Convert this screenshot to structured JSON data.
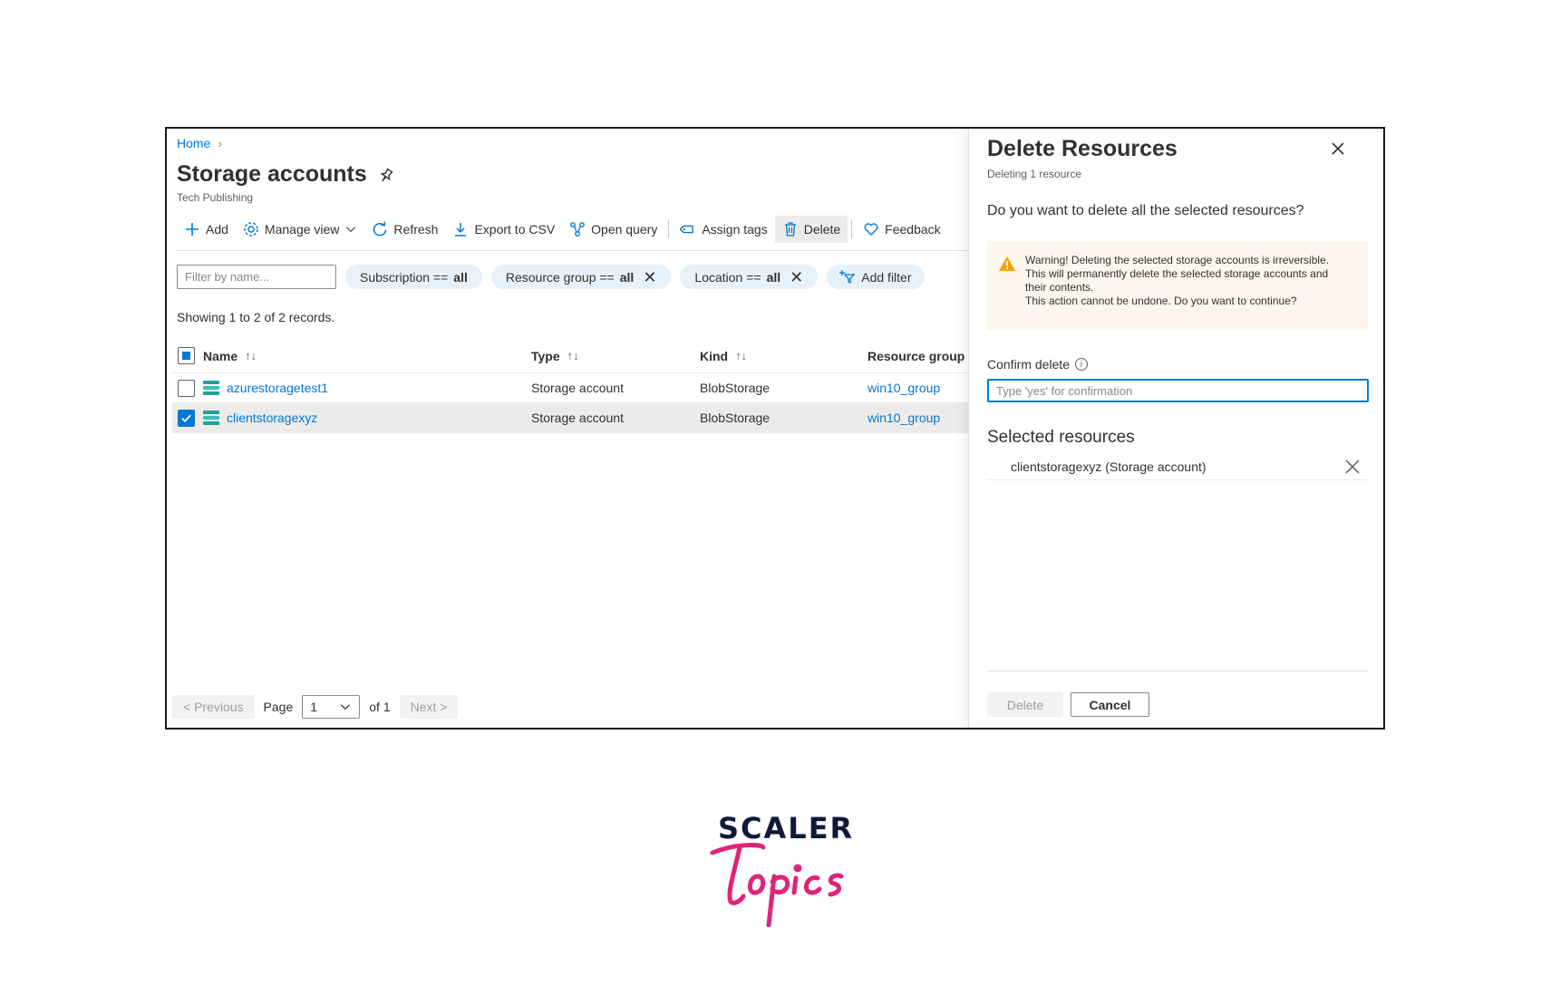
{
  "breadcrumb": {
    "home": "Home",
    "chevron": "›"
  },
  "page": {
    "title": "Storage accounts",
    "subtitle": "Tech Publishing"
  },
  "toolbar": {
    "add": "Add",
    "manage_view": "Manage view",
    "refresh": "Refresh",
    "export_csv": "Export to CSV",
    "open_query": "Open query",
    "assign_tags": "Assign tags",
    "delete": "Delete",
    "feedback": "Feedback"
  },
  "filters": {
    "name_placeholder": "Filter by name...",
    "subscription": {
      "label": "Subscription ==",
      "value": "all"
    },
    "resource_group": {
      "label": "Resource group ==",
      "value": "all"
    },
    "location": {
      "label": "Location ==",
      "value": "all"
    },
    "add_filter": "Add filter",
    "remove_glyph": "✕"
  },
  "records_text": "Showing 1 to 2 of 2 records.",
  "table": {
    "columns": {
      "name": "Name",
      "type": "Type",
      "kind": "Kind",
      "resource_group": "Resource group"
    },
    "sort_glyph": "↑↓",
    "rows": [
      {
        "name": "azurestoragetest1",
        "type": "Storage account",
        "kind": "BlobStorage",
        "resource_group": "win10_group",
        "checked": false
      },
      {
        "name": "clientstoragexyz",
        "type": "Storage account",
        "kind": "BlobStorage",
        "resource_group": "win10_group",
        "checked": true
      }
    ]
  },
  "pager": {
    "previous": "< Previous",
    "page_label": "Page",
    "page_value": "1",
    "of_label": "of 1",
    "next": "Next >"
  },
  "panel": {
    "title": "Delete Resources",
    "subtitle": "Deleting 1 resource",
    "question": "Do you want to delete all the selected resources?",
    "warning_lines": [
      "Warning! Deleting the selected storage accounts is irreversible.",
      "This will permanently delete the selected storage accounts and",
      "their contents.",
      "This action cannot be undone. Do you want to continue?"
    ],
    "confirm_label": "Confirm delete",
    "confirm_placeholder": "Type 'yes' for confirmation",
    "info_glyph": "i",
    "selected_title": "Selected resources",
    "selected_item": "clientstoragexyz (Storage account)",
    "delete_button": "Delete",
    "cancel_button": "Cancel"
  },
  "logo": {
    "top": "SCALER",
    "bottom": "Topics"
  },
  "colors": {
    "accent": "#0078d4",
    "warning": "#f7a100",
    "logo_navy": "#0f1a3a",
    "logo_pink": "#e0237a"
  }
}
